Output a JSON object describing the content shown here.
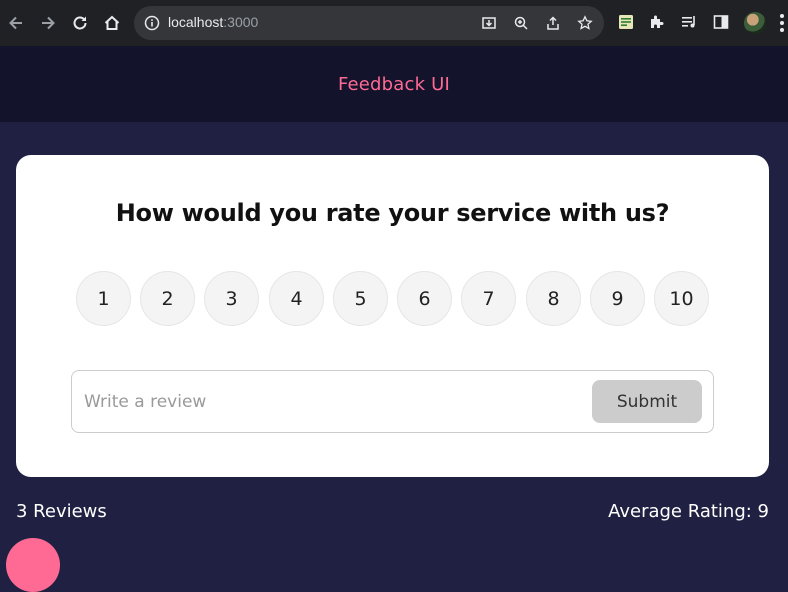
{
  "browser": {
    "url_host": "localhost",
    "url_port": ":3000"
  },
  "header": {
    "title": "Feedback UI"
  },
  "card": {
    "question": "How would you rate your service with us?",
    "ratings": [
      "1",
      "2",
      "3",
      "4",
      "5",
      "6",
      "7",
      "8",
      "9",
      "10"
    ],
    "review": {
      "value": "",
      "placeholder": "Write a review"
    },
    "submit_label": "Submit"
  },
  "stats": {
    "review_count": "3 Reviews",
    "average_rating": "Average Rating: 9"
  },
  "colors": {
    "background": "#202142",
    "header_bg": "#13132b",
    "accent": "#ff6a95",
    "card": "#ffffff",
    "submit_disabled": "#cccccc"
  }
}
